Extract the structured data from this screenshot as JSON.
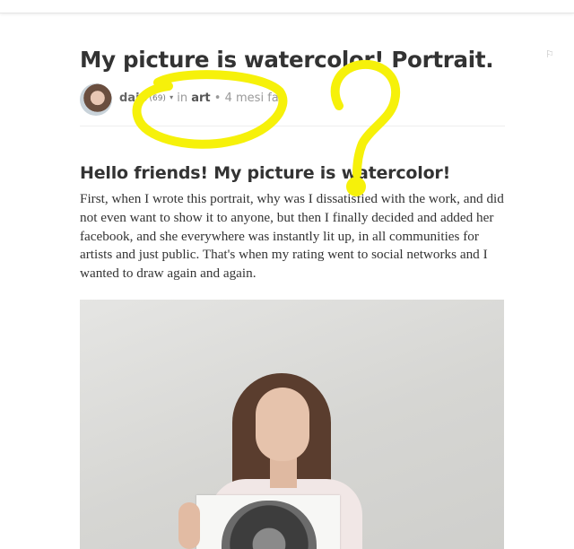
{
  "post": {
    "title": "My picture is watercolor! Portrait.",
    "author": "daio",
    "reputation": "(69)",
    "caret": "▾",
    "in_label": "in",
    "category": "art",
    "separator": "•",
    "time": "4 mesi fa",
    "flag_icon": "flag-icon",
    "subtitle": "Hello friends! My picture is watercolor!",
    "body": "First, when I wrote this portrait, why was I dissatisfied with the work, and did not even want to show it to anyone, but then I finally decided and added her facebook, and she everywhere was instantly lit up, in all communities for artists and just public. That's when my rating went to social networks and I wanted to draw again and again.",
    "image_alt_label": "photo of woman holding a drawing"
  },
  "colors": {
    "annotation": "#f6f10a",
    "text": "#333333",
    "meta": "#999999"
  }
}
